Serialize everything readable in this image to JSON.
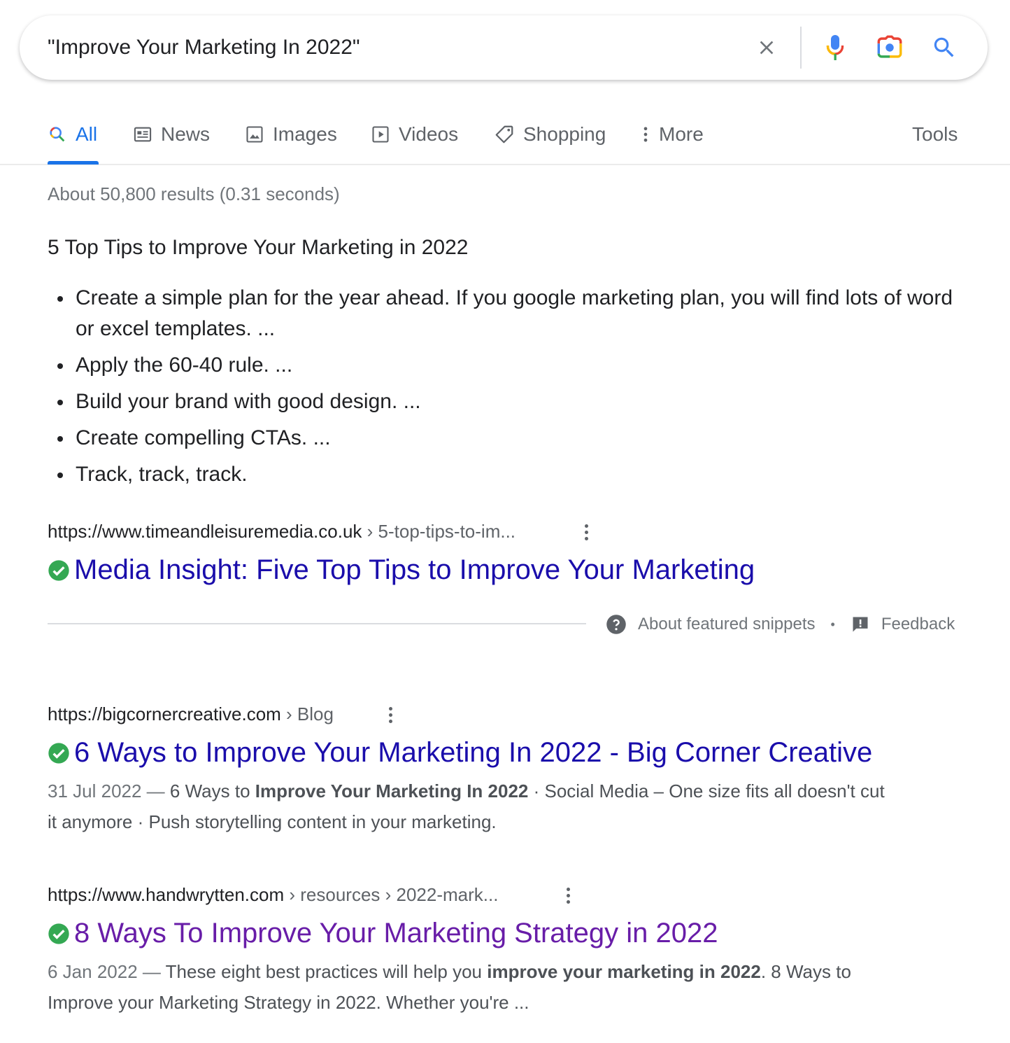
{
  "search": {
    "query": "\"Improve Your Marketing In 2022\""
  },
  "tabs": [
    {
      "label": "All"
    },
    {
      "label": "News"
    },
    {
      "label": "Images"
    },
    {
      "label": "Videos"
    },
    {
      "label": "Shopping"
    },
    {
      "label": "More"
    }
  ],
  "tools_label": "Tools",
  "result_stats": "About 50,800 results (0.31 seconds)",
  "featured_snippet": {
    "heading": "5 Top Tips to Improve Your Marketing in 2022",
    "items": [
      "Create a simple plan for the year ahead. If you google marketing plan, you will find lots of word or excel templates. ...",
      "Apply the 60-40 rule. ...",
      "Build your brand with good design. ...",
      "Create compelling CTAs. ...",
      "Track, track, track."
    ],
    "url": "https://www.timeandleisuremedia.co.uk",
    "crumbs": " › 5-top-tips-to-im...",
    "title": "Media Insight: Five Top Tips to Improve Your Marketing",
    "footer": {
      "about": "About featured snippets",
      "separator": "•",
      "feedback": "Feedback"
    }
  },
  "results": [
    {
      "url": "https://bigcornercreative.com",
      "crumbs": " › Blog",
      "title": "6 Ways to Improve Your Marketing In 2022 - Big Corner Creative",
      "date": "31 Jul 2022",
      "dash": " — ",
      "text1": "6 Ways to ",
      "bold1": "Improve Your Marketing In 2022",
      "text2": " · Social Media – One size fits all doesn't cut it anymore · Push storytelling content in your marketing."
    },
    {
      "url": "https://www.handwrytten.com",
      "crumbs": " › resources › 2022-mark...",
      "title": "8 Ways To Improve Your Marketing Strategy in 2022",
      "date": "6 Jan 2022",
      "dash": " — ",
      "text1": "These eight best practices will help you ",
      "bold1": "improve your marketing in 2022",
      "text2": ". 8 Ways to Improve your Marketing Strategy in 2022. Whether you're ..."
    }
  ],
  "colors": {
    "link": "#1a0dab",
    "visited_link": "#681da8",
    "accent": "#1a73e8",
    "verified_check": "#34a853"
  }
}
